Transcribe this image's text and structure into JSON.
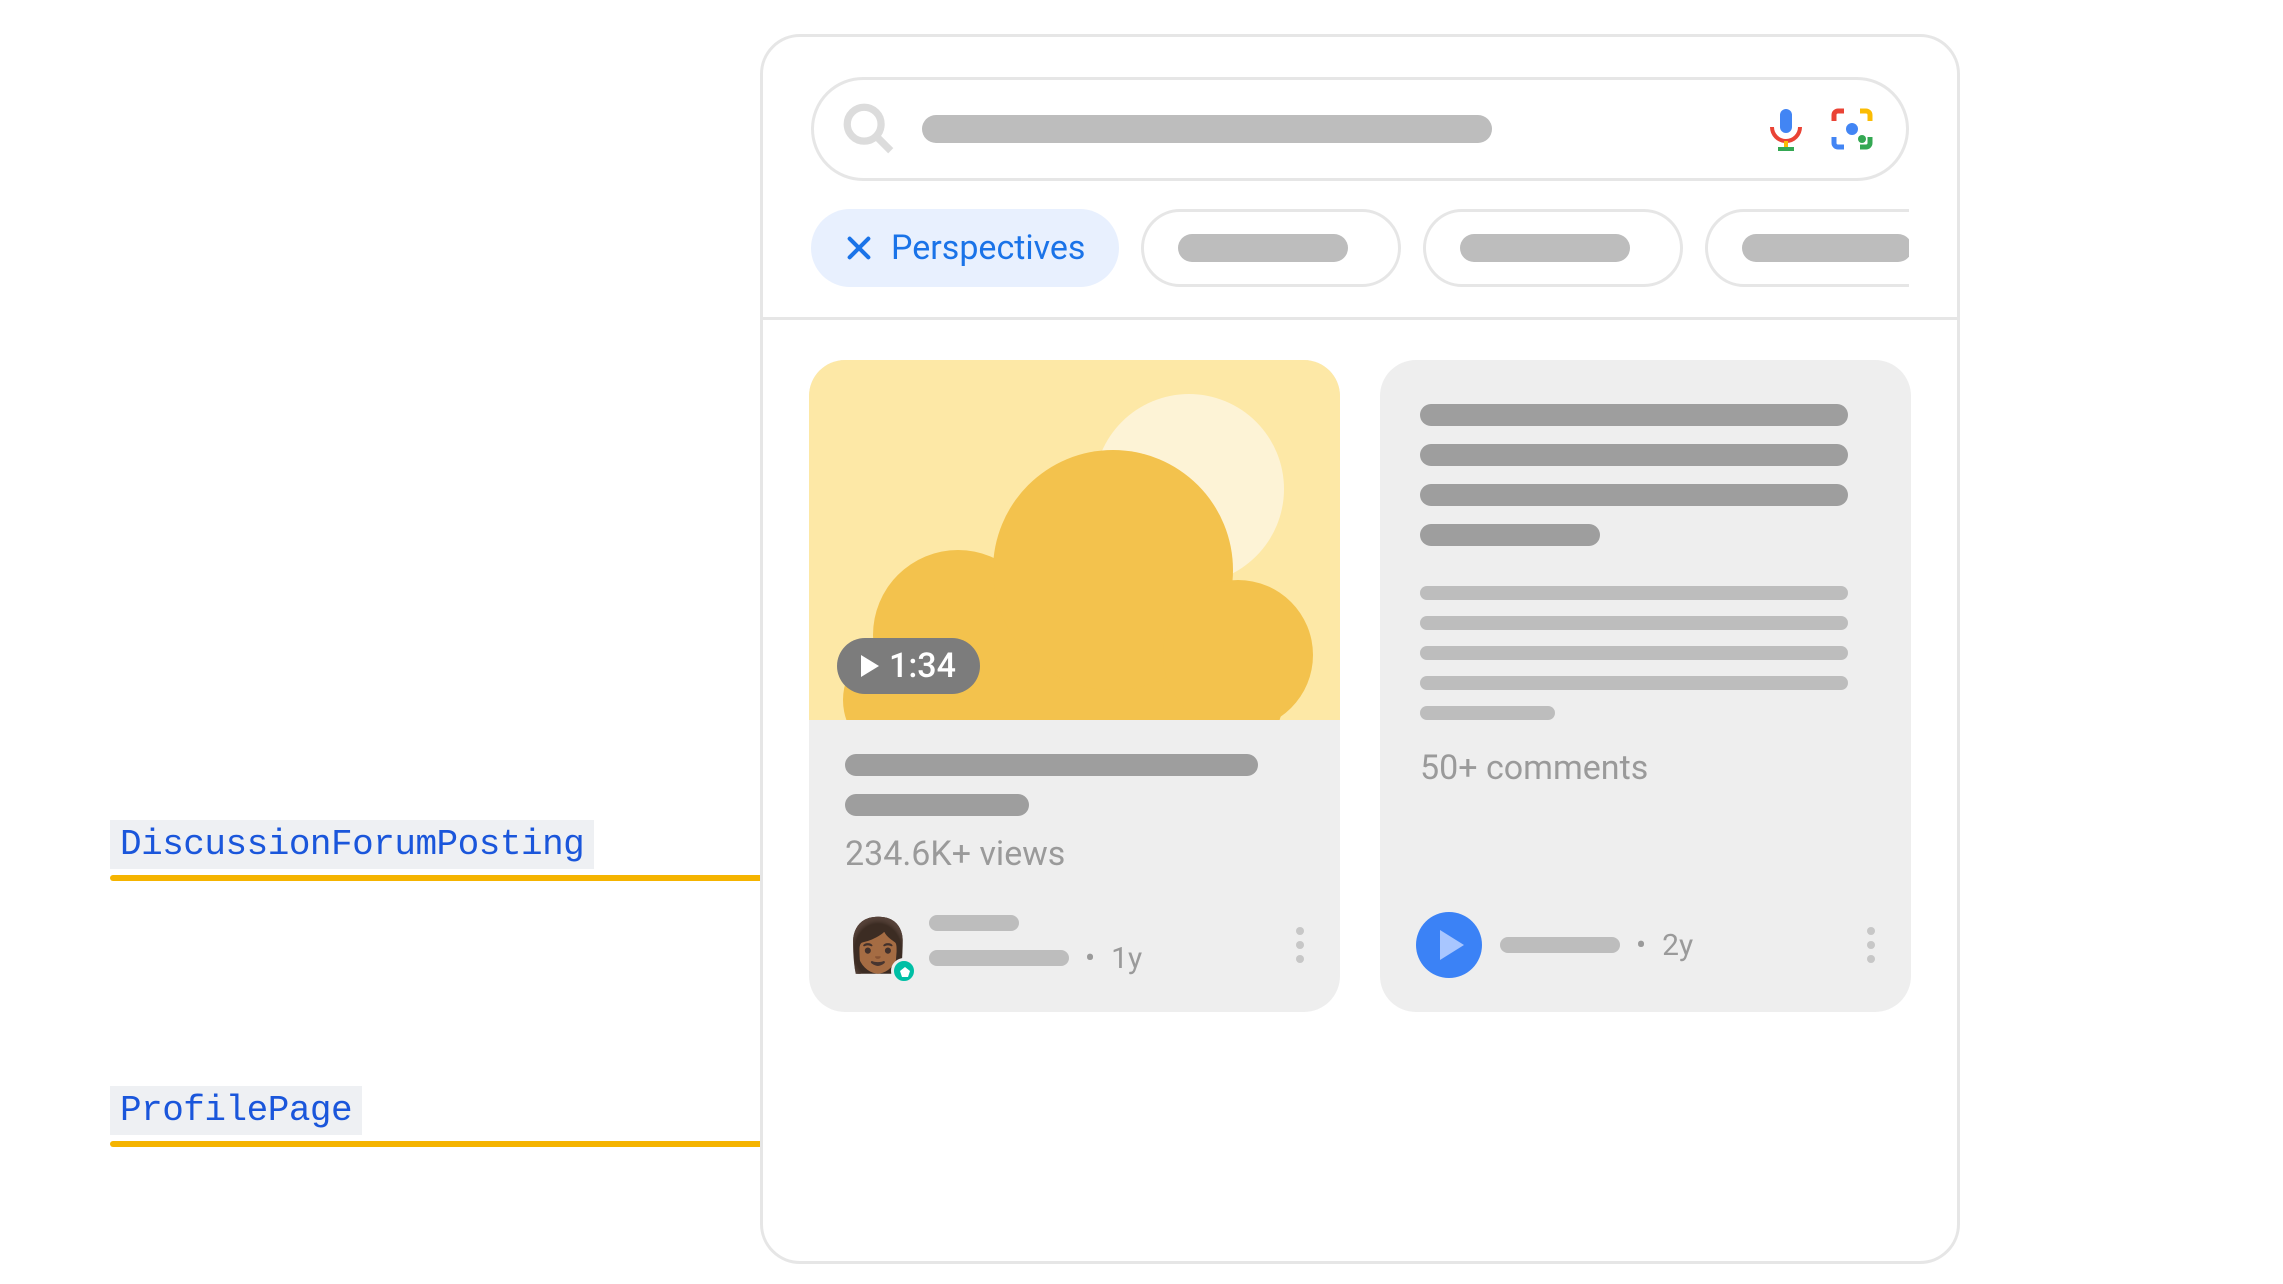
{
  "annotations": {
    "forum_label": "DiscussionForumPosting",
    "profile_label": "ProfilePage"
  },
  "chips": {
    "active_label": "Perspectives"
  },
  "card1": {
    "duration": "1:34",
    "views": "234.6K+ views",
    "age": "1y"
  },
  "card2": {
    "comments": "50+ comments",
    "age": "2y"
  }
}
